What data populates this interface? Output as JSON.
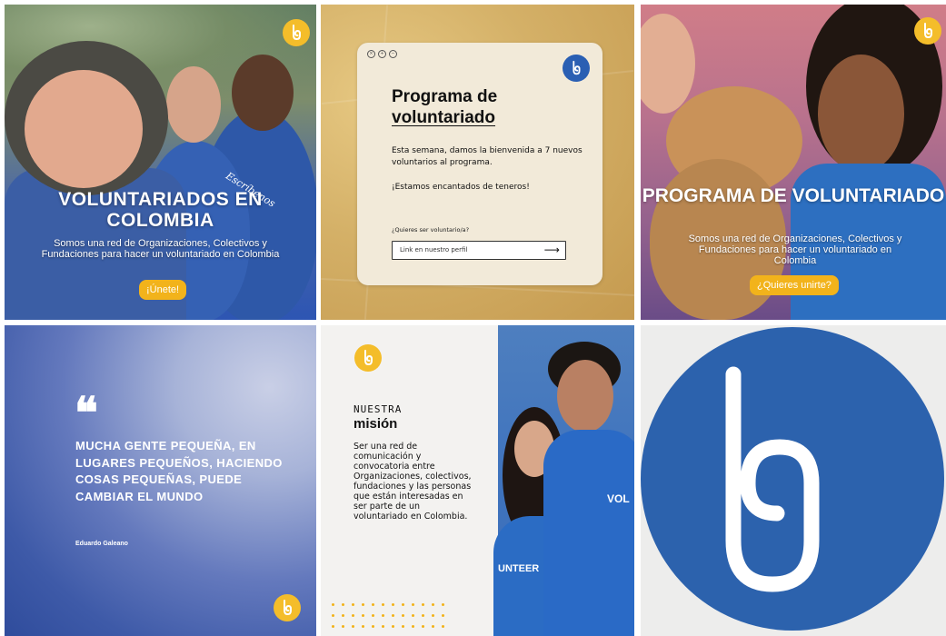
{
  "tiles": {
    "t1": {
      "title": "VOLUNTARIADOS EN COLOMBIA",
      "subtitle": "Somos una red de Organizaciones, Colectivos y Fundaciones para hacer un voluntariado en Colombia",
      "cta": "¡Únete!",
      "script_text": "Escríbenos",
      "logo_icon": "lo-logo-icon"
    },
    "t2": {
      "window_controls": [
        "×",
        "+",
        "−"
      ],
      "title_line1": "Programa de",
      "title_line2": "voluntariado",
      "paragraph1": "Esta semana, damos la bienvenida a 7 nuevos voluntarios al programa.",
      "paragraph2": "¡Estamos encantados de teneros!",
      "question": "¿Quieres ser voluntario/a?",
      "input_text": "Link en nuestro perfil",
      "arrow": "⟶"
    },
    "t3": {
      "title": "PROGRAMA DE VOLUNTARIADO",
      "subtitle": "Somos una red de Organizaciones, Colectivos y Fundaciones para hacer un voluntariado en Colombia",
      "cta": "¿Quieres unirte?"
    },
    "t4": {
      "quote_mark": "❝",
      "quote": "MUCHA GENTE PEQUEÑA, EN LUGARES PEQUEÑOS, HACIENDO COSAS PEQUEÑAS, PUEDE CAMBIAR EL MUNDO",
      "author": "Eduardo Galeano"
    },
    "t5": {
      "heading_small": "NUESTRA",
      "heading": "misión",
      "body": "Ser una red de comunicación y convocatoria entre Organizaciones, colectivos, fundaciones y las personas que están interesadas en ser parte de un voluntariado en Colombia.",
      "shirt_text_1": "VOL",
      "shirt_text_2": "UNTEER"
    },
    "t6": {
      "logo_icon": "lo-big-logo-icon"
    }
  },
  "colors": {
    "brand_blue": "#2c62ad",
    "brand_yellow": "#f2b31b"
  }
}
